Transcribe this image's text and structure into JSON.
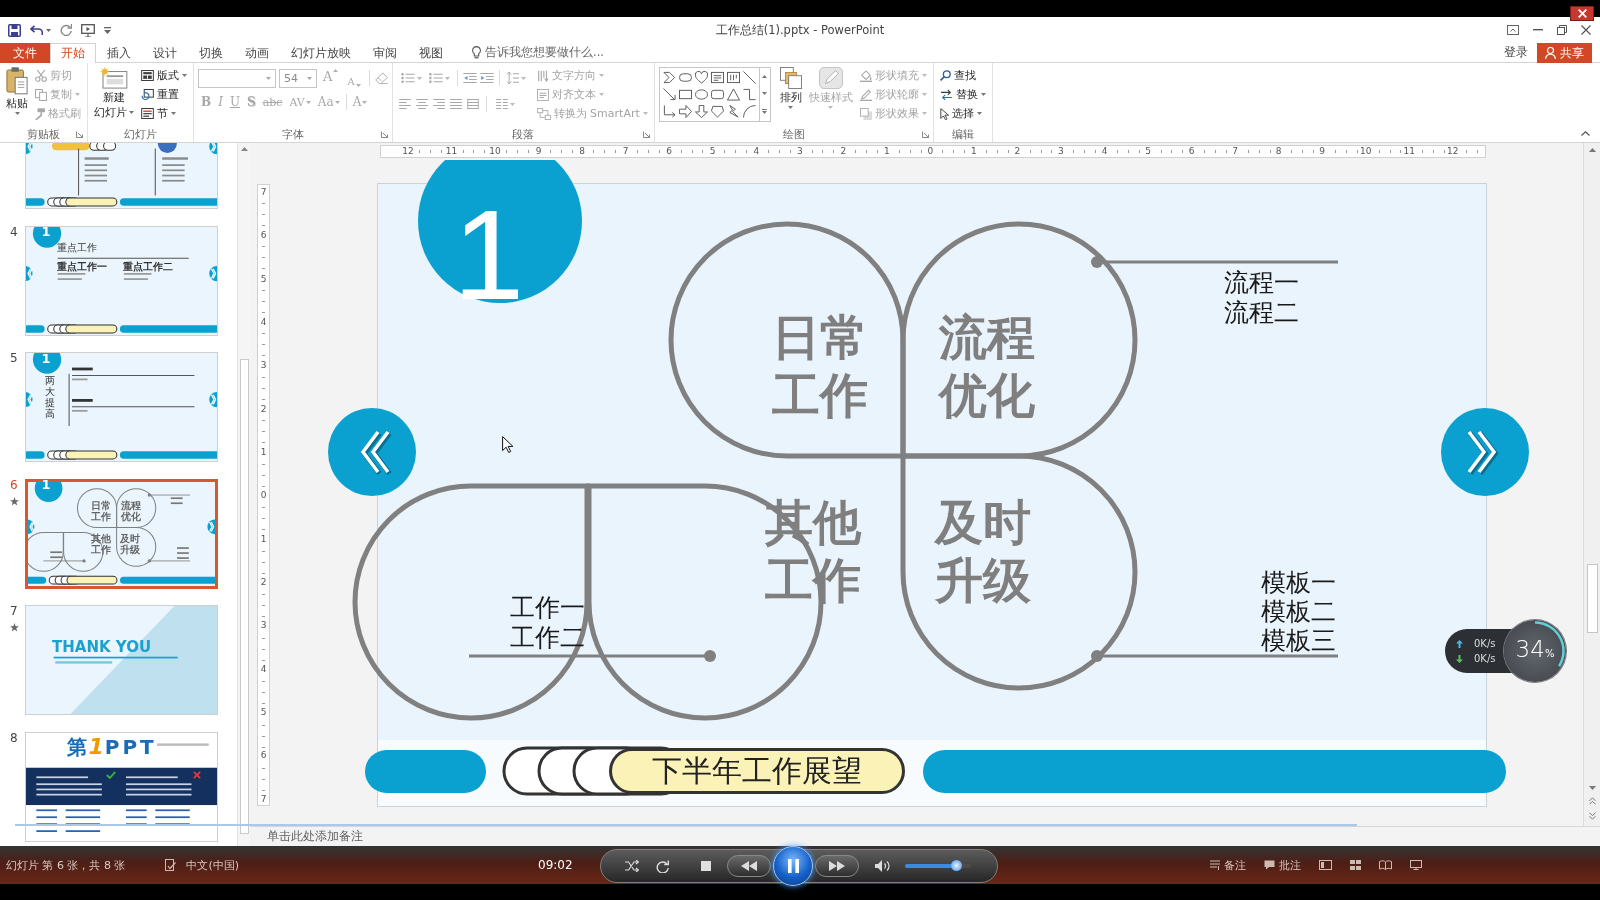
{
  "window": {
    "title": "工作总结(1).pptx - PowerPoint"
  },
  "tabs": [
    {
      "label": "文件",
      "kind": "file",
      "selected": false
    },
    {
      "label": "开始",
      "kind": "tab",
      "selected": true
    },
    {
      "label": "插入",
      "kind": "tab",
      "selected": false
    },
    {
      "label": "设计",
      "kind": "tab",
      "selected": false
    },
    {
      "label": "切换",
      "kind": "tab",
      "selected": false
    },
    {
      "label": "动画",
      "kind": "tab",
      "selected": false
    },
    {
      "label": "幻灯片放映",
      "kind": "tab",
      "selected": false
    },
    {
      "label": "审阅",
      "kind": "tab",
      "selected": false
    },
    {
      "label": "视图",
      "kind": "tab",
      "selected": false
    }
  ],
  "tell_me": {
    "placeholder": "告诉我您想要做什么..."
  },
  "account": {
    "sign_in": "登录",
    "share": "共享"
  },
  "ribbon": {
    "clipboard": {
      "label": "剪贴板",
      "paste": "粘贴",
      "commands": [
        {
          "label": "剪切",
          "disabled": true,
          "dropdown": false
        },
        {
          "label": "复制",
          "disabled": true,
          "dropdown": true
        },
        {
          "label": "格式刷",
          "disabled": true,
          "dropdown": false
        }
      ]
    },
    "slides": {
      "label": "幻灯片",
      "new_slide": [
        "新建",
        "幻灯片"
      ],
      "commands": [
        {
          "label": "版式",
          "disabled": false,
          "dropdown": true
        },
        {
          "label": "重置",
          "disabled": false,
          "dropdown": false
        },
        {
          "label": "节",
          "disabled": false,
          "dropdown": true
        }
      ]
    },
    "font": {
      "label": "字体",
      "size": "54",
      "size_buttons": [
        {
          "label": "A",
          "kind": "grow",
          "disabled": true
        },
        {
          "label": "A",
          "kind": "shrink",
          "disabled": true
        }
      ],
      "buttons": [
        {
          "label": "B",
          "kind": "bold",
          "disabled": true
        },
        {
          "label": "I",
          "kind": "italic",
          "disabled": true
        },
        {
          "label": "U",
          "kind": "underline",
          "disabled": true
        },
        {
          "label": "S",
          "kind": "shadow",
          "disabled": true
        },
        {
          "label": "abc",
          "kind": "strike",
          "disabled": true
        },
        {
          "label": "AV",
          "kind": "spacing",
          "disabled": true
        },
        {
          "label": "Aa",
          "kind": "case",
          "disabled": true
        },
        {
          "label": "A",
          "kind": "color",
          "disabled": true
        }
      ]
    },
    "paragraph": {
      "label": "段落",
      "commands": [
        {
          "label": "文字方向",
          "disabled": true,
          "dropdown": true
        },
        {
          "label": "对齐文本",
          "disabled": true,
          "dropdown": true
        },
        {
          "label": "转换为 SmartArt",
          "disabled": true,
          "dropdown": true
        }
      ]
    },
    "drawing": {
      "label": "绘图",
      "arrange": "排列",
      "quick_styles": {
        "label": "快速样式",
        "disabled": true
      },
      "commands": [
        {
          "label": "形状填充",
          "disabled": true,
          "dropdown": true
        },
        {
          "label": "形状轮廓",
          "disabled": true,
          "dropdown": true
        },
        {
          "label": "形状效果",
          "disabled": true,
          "dropdown": true
        }
      ]
    },
    "editing": {
      "label": "编辑",
      "commands": [
        {
          "label": "查找",
          "disabled": false,
          "dropdown": false
        },
        {
          "label": "替换",
          "disabled": false,
          "dropdown": true
        },
        {
          "label": "选择",
          "disabled": false,
          "dropdown": true
        }
      ]
    }
  },
  "slides_pane": {
    "thumbnails": [
      {
        "kind": "agenda",
        "selected": false
      },
      {
        "number": "4",
        "kind": "content",
        "selected": false,
        "starred": false,
        "badge": "1",
        "texts": [
          "重点工作",
          "重点工作一",
          "重点工作二"
        ]
      },
      {
        "number": "5",
        "kind": "outline",
        "selected": false,
        "starred": false,
        "badge": "1",
        "texts": [
          "两大提高"
        ]
      },
      {
        "number": "6",
        "kind": "diagram",
        "selected": true,
        "starred": true,
        "badge": "1",
        "texts": [
          "日常工作",
          "流程优化",
          "其他工作",
          "及时升级"
        ]
      },
      {
        "number": "7",
        "kind": "closing",
        "selected": false,
        "starred": true,
        "texts": [
          "THANK YOU"
        ]
      },
      {
        "number": "8",
        "kind": "brand",
        "selected": false,
        "starred": false,
        "texts": [
          "第",
          "1",
          "PPT"
        ]
      }
    ]
  },
  "rulers": {
    "horizontal": [
      "12",
      "11",
      "10",
      "9",
      "8",
      "7",
      "6",
      "5",
      "4",
      "3",
      "2",
      "1",
      "0",
      "1",
      "2",
      "3",
      "4",
      "5",
      "6",
      "7",
      "8",
      "9",
      "10",
      "11",
      "12"
    ],
    "vertical": [
      "7",
      "6",
      "5",
      "4",
      "3",
      "2",
      "1",
      "0",
      "1",
      "2",
      "3",
      "4",
      "5",
      "6",
      "7"
    ]
  },
  "slide": {
    "badge": "1",
    "petals": [
      "日常工作",
      "流程优化",
      "其他工作",
      "及时升级"
    ],
    "callouts": [
      {
        "lines": [
          "流程一",
          "流程二"
        ]
      },
      {
        "lines": [
          "工作一",
          "工作二"
        ]
      },
      {
        "lines": [
          "模板一",
          "模板二",
          "模板三"
        ]
      }
    ],
    "footer_title": "下半年工作展望"
  },
  "notes": {
    "placeholder": "单击此处添加备注"
  },
  "status_bar": {
    "slide_info": "幻灯片 第 6 张，共 8 张",
    "language": "中文(中国)",
    "notes": "备注",
    "comments": "批注"
  },
  "player": {
    "time": "09:02",
    "playing": true,
    "volume": {
      "level": 0.77
    }
  },
  "speed_monitor": {
    "upload": "0K/s",
    "download": "0K/s",
    "value": "34",
    "unit": "%"
  }
}
